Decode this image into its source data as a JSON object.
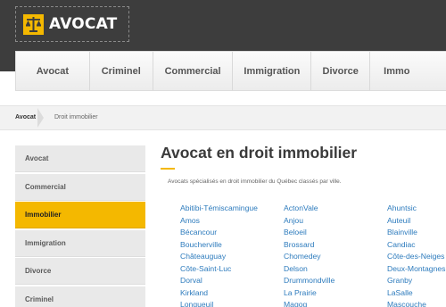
{
  "header": {
    "logo_text": "AVOCAT",
    "logo_icon": "scales-of-justice-icon"
  },
  "nav": {
    "items": [
      "Avocat",
      "Criminel",
      "Commercial",
      "Immigration",
      "Divorce",
      "Immo"
    ]
  },
  "breadcrumb": {
    "home": "Avocat",
    "current": "Droit immobilier"
  },
  "sidebar": {
    "items": [
      "Avocat",
      "Commercial",
      "Immobilier",
      "Immigration",
      "Divorce",
      "Criminel"
    ],
    "active_index": 2
  },
  "main": {
    "title": "Avocat en droit immobilier",
    "intro": "Avocats spécialisés en droit immobilier du Québec classés par ville.",
    "columns": [
      [
        "Abitibi-Témiscamingue",
        "Amos",
        "Bécancour",
        "Boucherville",
        "Châteauguay",
        "Côte-Saint-Luc",
        "Dorval",
        "Kirkland",
        "Longueuil"
      ],
      [
        "ActonVale",
        "Anjou",
        "Beloeil",
        "Brossard",
        "Chomedey",
        "Delson",
        "Drummondville",
        "La Prairie",
        "Magog"
      ],
      [
        "Ahuntsic",
        "Auteuil",
        "Blainville",
        "Candiac",
        "Côte-des-Neiges",
        "Deux-Montagnes",
        "Granby",
        "LaSalle",
        "Mascouche"
      ]
    ]
  },
  "colors": {
    "accent": "#f4b800",
    "header_bg": "#3d3d3d",
    "link": "#2d7bbd"
  }
}
